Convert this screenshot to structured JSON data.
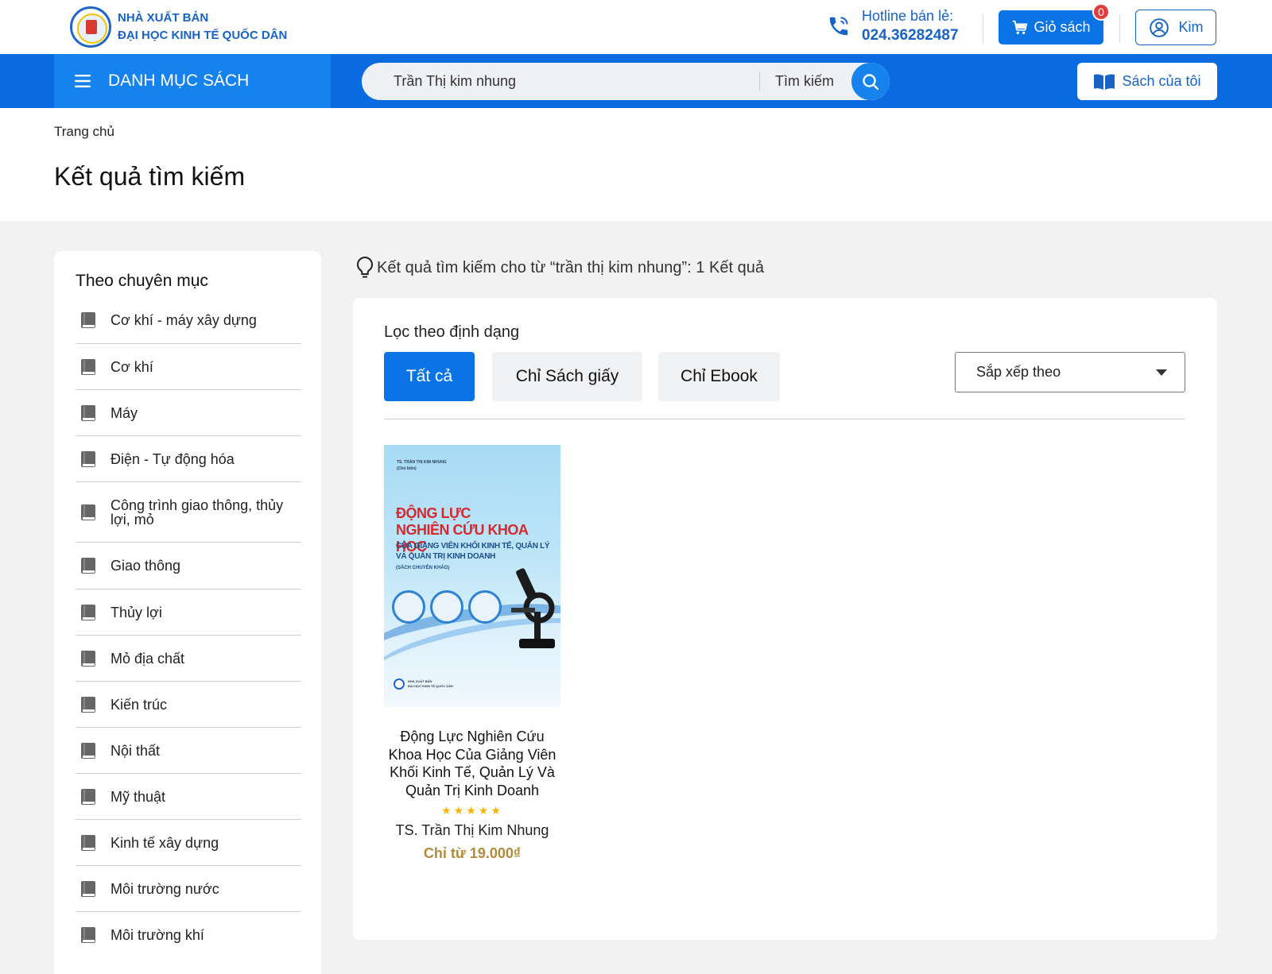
{
  "header": {
    "publisher_line1": "NHÀ XUẤT BẢN",
    "publisher_line2": "ĐẠI HỌC KINH TẾ QUỐC DÂN",
    "hotline_label": "Hotline bán lẻ:",
    "hotline_number": "024.36282487",
    "cart_label": "Giỏ sách",
    "cart_count": "0",
    "user_label": "Kim"
  },
  "nav": {
    "category_label": "DANH MỤC SÁCH",
    "search_value": "Trần Thị kim nhung",
    "search_label": "Tìm kiếm",
    "my_books_label": "Sách của tôi"
  },
  "page": {
    "breadcrumb": "Trang chủ",
    "title": "Kết quả tìm kiếm"
  },
  "sidebar": {
    "title": "Theo chuyên mục",
    "items": [
      {
        "label": "Cơ khí - máy xây dựng"
      },
      {
        "label": "Cơ khí"
      },
      {
        "label": "Máy"
      },
      {
        "label": "Điện - Tự động hóa"
      },
      {
        "label": "Công trình giao thông, thủy lợi, mỏ"
      },
      {
        "label": "Giao thông"
      },
      {
        "label": "Thủy lợi"
      },
      {
        "label": "Mỏ địa chất"
      },
      {
        "label": "Kiến trúc"
      },
      {
        "label": "Nội thất"
      },
      {
        "label": "Mỹ thuật"
      },
      {
        "label": "Kinh tế xây dựng"
      },
      {
        "label": "Môi trường nước"
      },
      {
        "label": "Môi trường khí"
      }
    ]
  },
  "results": {
    "summary": "Kết quả tìm kiếm cho từ “trần thị kim nhung”: 1 Kết quả",
    "filter_title": "Lọc theo định dạng",
    "filters": {
      "all": "Tất cả",
      "paper": "Chỉ Sách giấy",
      "ebook": "Chỉ Ebook"
    },
    "sort_label": "Sắp xếp theo",
    "products": [
      {
        "cover_author": "TS. TRẦN THỊ KIM NHUNG",
        "cover_role": "(Chủ biên)",
        "cover_title_1": "ĐỘNG LỰC",
        "cover_title_2": "NGHIÊN CỨU KHOA HỌC",
        "cover_sub_1": "CỦA GIẢNG VIÊN KHỐI KINH TẾ, QUẢN LÝ",
        "cover_sub_2": "VÀ QUẢN TRỊ KINH DOANH",
        "cover_note": "(SÁCH CHUYÊN KHẢO)",
        "cover_publisher_1": "NHÀ XUẤT BẢN",
        "cover_publisher_2": "ĐẠI HỌC KINH TẾ QUỐC DÂN",
        "title": "Động Lực Nghiên Cứu Khoa Học Của Giảng Viên Khối Kinh Tế, Quản Lý Và Quản Trị Kinh Doanh",
        "rating": 5,
        "author": "TS. Trần Thị Kim Nhung",
        "price": "Chỉ từ 19.000₫"
      }
    ]
  },
  "colors": {
    "primary": "#0a73e5",
    "nav_bg": "#0a6adf",
    "price": "#b28a3a",
    "badge": "#e23d3d",
    "star": "#f7b500"
  }
}
